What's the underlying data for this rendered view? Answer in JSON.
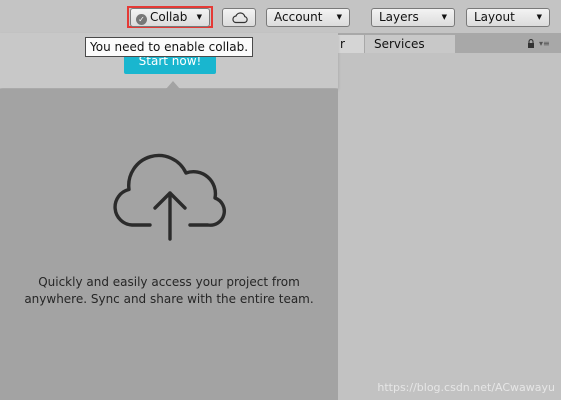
{
  "toolbar": {
    "collab_label": "Collab",
    "account_label": "Account",
    "layers_label": "Layers",
    "layout_label": "Layout",
    "dropdown_arrow": "▼",
    "check_glyph": "✓"
  },
  "tooltip": {
    "text": "You need to enable collab."
  },
  "tabs": {
    "previous_partial": "r",
    "services": "Services"
  },
  "popup": {
    "start_button": "Start now!",
    "description_line1": "Quickly and easily access your project from",
    "description_line2": "anywhere. Sync and share with the entire team."
  },
  "watermark": "https://blog.csdn.net/ACwawayu",
  "colors": {
    "accent_button": "#19b6cf",
    "highlight_border": "#e53935"
  },
  "icons": [
    "collab-check-icon",
    "cloud-icon",
    "lock-icon",
    "menu-icon",
    "cloud-upload-icon"
  ]
}
